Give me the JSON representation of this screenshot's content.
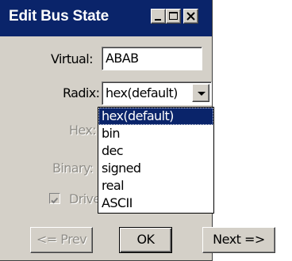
{
  "window": {
    "title": "Edit Bus State",
    "minimize_icon": "minimize-icon",
    "maximize_icon": "maximize-icon",
    "close_icon": "close-icon"
  },
  "form": {
    "virtual_label": "Virtual:",
    "virtual_value": "ABAB",
    "radix_label": "Radix:",
    "radix_value": "hex(default)",
    "hex_label": "Hex:",
    "binary_label": "Binary:",
    "drive_label": "Drive",
    "drive_checked": true
  },
  "radix_options": [
    "hex(default)",
    "bin",
    "dec",
    "signed",
    "real",
    "ASCII"
  ],
  "radix_selected_index": 0,
  "buttons": {
    "prev": "<= Prev",
    "ok": "OK",
    "next": "Next =>"
  }
}
